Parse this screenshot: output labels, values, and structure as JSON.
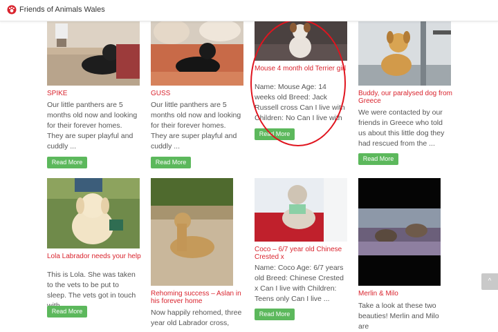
{
  "site": {
    "brand": "Friends of Animals Wales"
  },
  "read_more_label": "Read More",
  "cards": [
    {
      "title": "SPIKE",
      "excerpt": "Our little panthers are 5 months old now and looking for their forever homes. They are super playful and cuddly ..."
    },
    {
      "title": "GUSS",
      "excerpt": "Our little panthers are 5 months old now and looking for their forever homes. They are super playful and cuddly ..."
    },
    {
      "title": "Mouse 4 month old Terrier girl",
      "excerpt": "Name: Mouse Age: 14 weeks old Breed: Jack Russell cross Can I live with Children: No Can I live with ..."
    },
    {
      "title": "Buddy, our paralysed dog from Greece",
      "excerpt": "We were contacted by our friends in Greece who told us about this little dog they had rescued from the ..."
    },
    {
      "title": "Lola Labrador needs your help",
      "excerpt": "This is Lola. She was taken to the vets to be put to sleep. The vets got in touch with ..."
    },
    {
      "title": "Rehoming success – Aslan in his forever home",
      "excerpt": "Now happily rehomed, three year old Labrador cross,"
    },
    {
      "title": "Coco – 6/7 year old Chinese Crested x",
      "excerpt": "Name: Coco Age: 6/7 years old Breed: Chinese Crested x Can I live with Children: Teens only Can I live ..."
    },
    {
      "title": "Merlin & Milo",
      "excerpt": "Take a look at these two beauties!  Merlin and Milo are"
    }
  ],
  "colors": {
    "accent": "#d9232d",
    "button": "#5cb85c",
    "highlight": "#e0151f"
  }
}
